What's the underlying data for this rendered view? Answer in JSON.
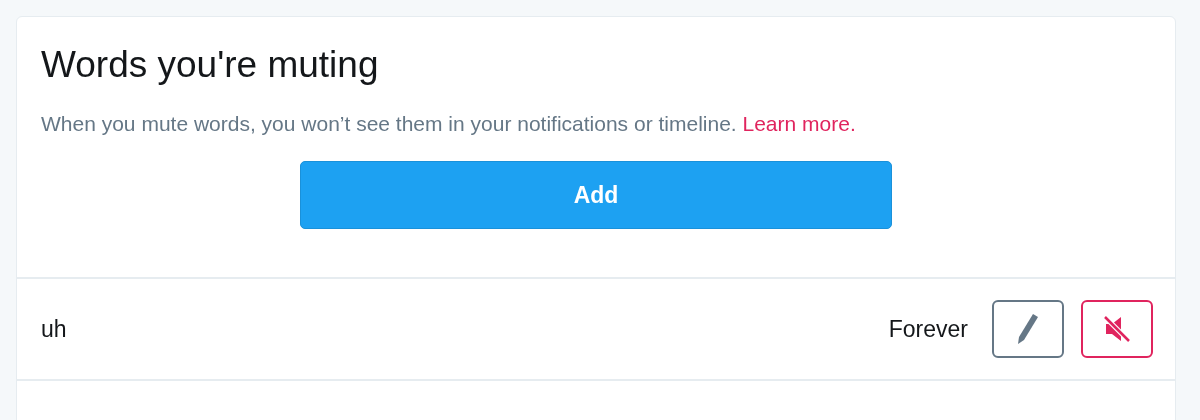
{
  "title": "Words you're muting",
  "description": "When you mute words, you won’t see them in your notifications or timeline.",
  "learn_more": "Learn more.",
  "add_button": "Add",
  "muted_words": [
    {
      "word": "uh",
      "duration": "Forever"
    }
  ]
}
